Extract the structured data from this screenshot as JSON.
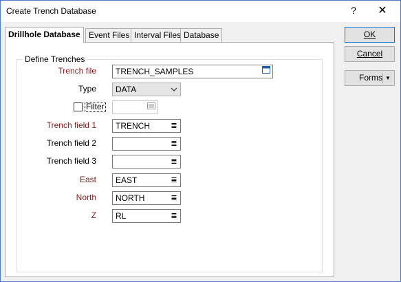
{
  "window": {
    "title": "Create Trench Database",
    "help_glyph": "?",
    "close_glyph": "✕"
  },
  "tabs": [
    {
      "label": "Drillhole Database",
      "active": true
    },
    {
      "label": "Event Files",
      "active": false
    },
    {
      "label": "Interval Files",
      "active": false
    },
    {
      "label": "Database",
      "active": false
    }
  ],
  "group": {
    "label": "Define Trenches"
  },
  "fields": {
    "trench_file": {
      "label": "Trench file",
      "value": "TRENCH_SAMPLES",
      "icon": "file-browse-icon"
    },
    "type": {
      "label": "Type",
      "value": "DATA",
      "icon": "chevron-down-icon"
    },
    "filter": {
      "label": "Filter",
      "checked": false,
      "value": "",
      "icon": "filter-list-icon"
    },
    "trench_field_1": {
      "label": "Trench field 1",
      "value": "TRENCH",
      "icon": "list-icon"
    },
    "trench_field_2": {
      "label": "Trench field 2",
      "value": "",
      "icon": "list-icon"
    },
    "trench_field_3": {
      "label": "Trench field 3",
      "value": "",
      "icon": "list-icon"
    },
    "east": {
      "label": "East",
      "value": "EAST",
      "icon": "list-icon"
    },
    "north": {
      "label": "North",
      "value": "NORTH",
      "icon": "list-icon"
    },
    "z": {
      "label": "Z",
      "value": "RL",
      "icon": "list-icon"
    }
  },
  "buttons": {
    "ok": {
      "label": "OK"
    },
    "cancel": {
      "label": "Cancel"
    },
    "forms": {
      "label": "Forms",
      "arrow": "▼"
    }
  },
  "colors": {
    "required_label": "#8b1a1a",
    "focus_border": "#0078d7",
    "window_border": "#4a7cc9"
  }
}
